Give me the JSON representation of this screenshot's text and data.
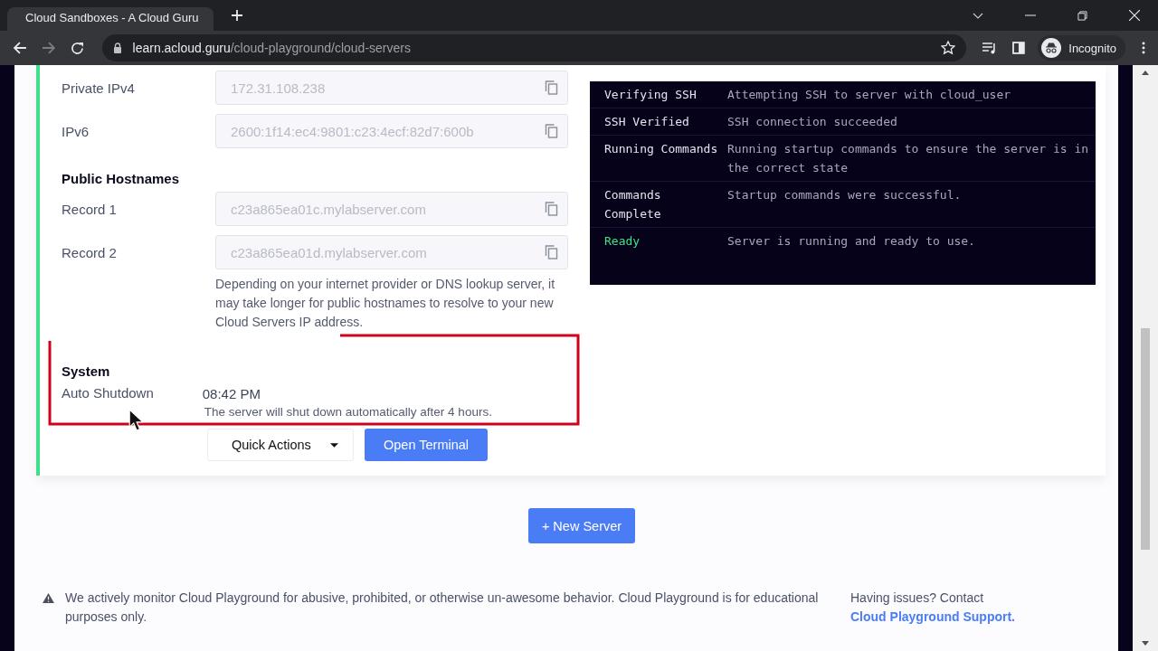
{
  "browser": {
    "tab_title": "Cloud Sandboxes - A Cloud Guru",
    "url_host": "learn.acloud.guru",
    "url_path": "/cloud-playground/cloud-servers",
    "profile": "Incognito"
  },
  "server": {
    "fields": [
      {
        "kind": "field",
        "label": "Private IPv4",
        "value": "172.31.108.238"
      },
      {
        "kind": "field",
        "label": "IPv6",
        "value": "2600:1f14:ec4:9801:c23:4ecf:82d7:600b"
      },
      {
        "kind": "heading",
        "label": "Public Hostnames"
      },
      {
        "kind": "field",
        "label": "Record 1",
        "value": "c23a865ea01c.mylabserver.com"
      },
      {
        "kind": "field",
        "label": "Record 2",
        "value": "c23a865ea01d.mylabserver.com"
      },
      {
        "kind": "note",
        "text": "Depending on your internet provider or DNS lookup server, it may take longer for public hostnames to resolve to your new Cloud Servers IP address."
      },
      {
        "kind": "heading",
        "label": "System"
      },
      {
        "kind": "setting",
        "label": "Auto Shutdown",
        "value": "08:42 PM",
        "description": "The server will shut down automatically after 4 hours."
      }
    ],
    "quick_actions": "Quick Actions",
    "open_terminal": "Open Terminal",
    "log": [
      {
        "status": "Verifying SSH",
        "message": "Attempting SSH to server with cloud_user",
        "color": "#e4e4ee"
      },
      {
        "status": "SSH Verified",
        "message": "SSH connection succeeded",
        "color": "#e4e4ee"
      },
      {
        "status": "Running Commands",
        "message": "Running startup commands to ensure the server is in the correct state",
        "color": "#e4e4ee"
      },
      {
        "status": "Commands Complete",
        "message": "Startup commands were successful.",
        "color": "#e4e4ee"
      },
      {
        "status": "Ready",
        "message": "Server is running and ready to use.",
        "color": "#3ee089"
      }
    ]
  },
  "new_server": "+ New Server",
  "footer": {
    "notice": "We actively monitor Cloud Playground for abusive, prohibited, or otherwise un-awesome behavior. Cloud Playground is for educational purposes only.",
    "help": "Having issues? Contact ",
    "help_link": "Cloud Playground Support."
  }
}
